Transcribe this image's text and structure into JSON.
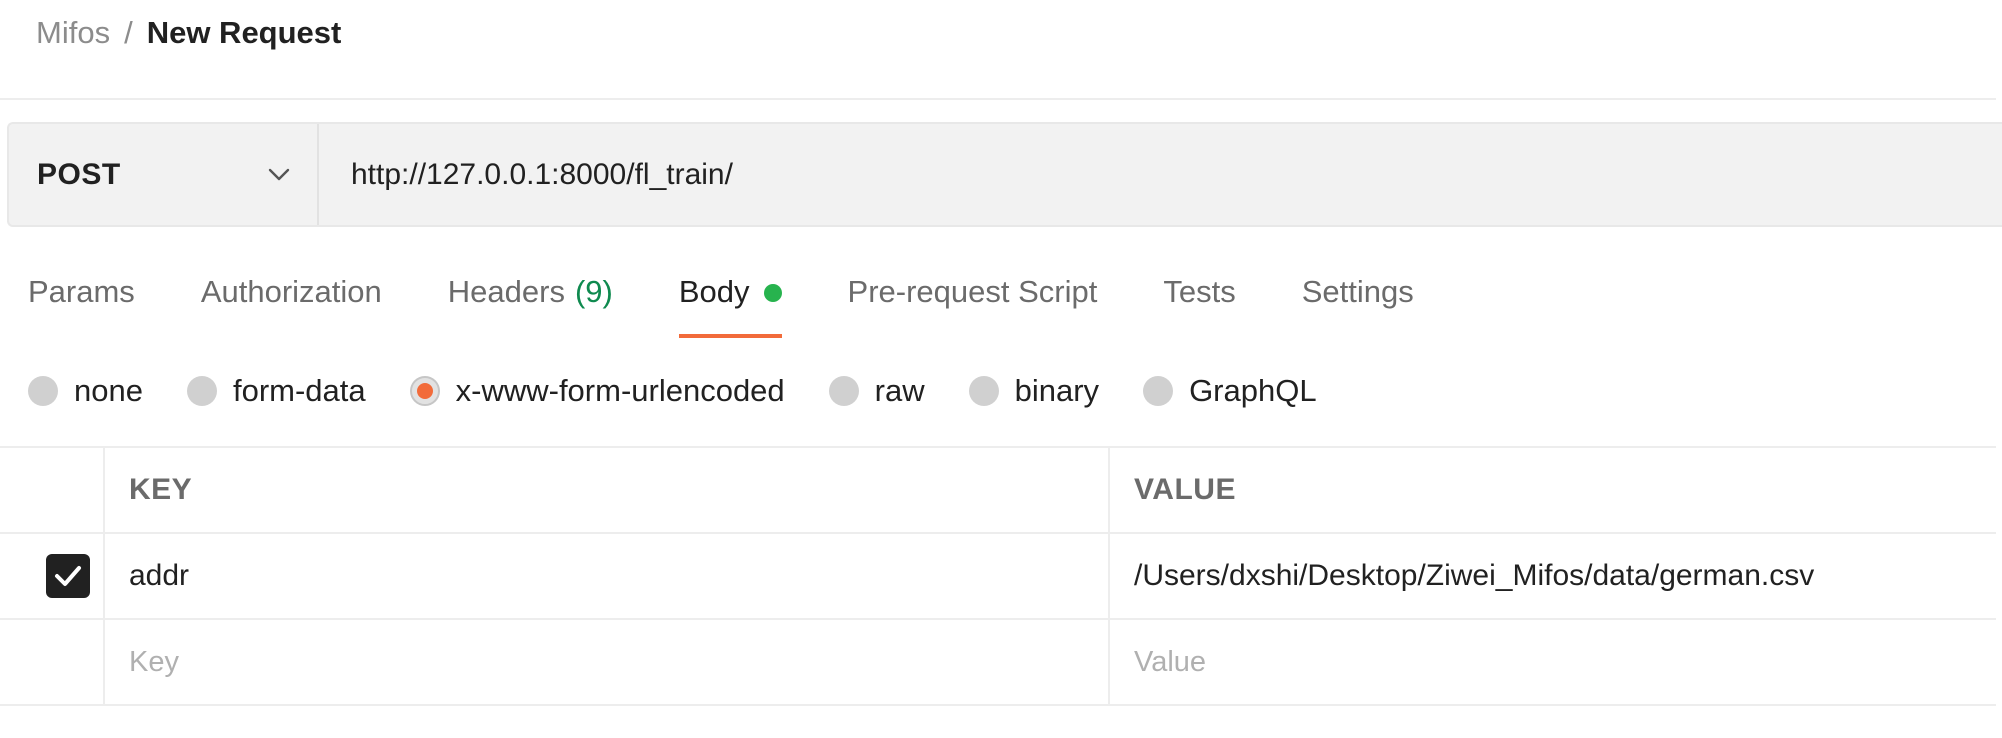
{
  "breadcrumb": {
    "parent": "Mifos",
    "separator": "/",
    "current": "New Request"
  },
  "request": {
    "method": "POST",
    "url": "http://127.0.0.1:8000/fl_train/"
  },
  "tabs": [
    {
      "label": "Params"
    },
    {
      "label": "Authorization"
    },
    {
      "label": "Headers",
      "count": "(9)"
    },
    {
      "label": "Body",
      "active": true,
      "status_color": "#27b34e"
    },
    {
      "label": "Pre-request Script"
    },
    {
      "label": "Tests"
    },
    {
      "label": "Settings"
    }
  ],
  "body_types": [
    {
      "label": "none"
    },
    {
      "label": "form-data"
    },
    {
      "label": "x-www-form-urlencoded",
      "selected": true
    },
    {
      "label": "raw"
    },
    {
      "label": "binary"
    },
    {
      "label": "GraphQL"
    }
  ],
  "table": {
    "headers": {
      "key": "KEY",
      "value": "VALUE"
    },
    "rows": [
      {
        "checked": true,
        "key": "addr",
        "value": "/Users/dxshi/Desktop/Ziwei_Mifos/data/german.csv"
      }
    ],
    "placeholder": {
      "key": "Key",
      "value": "Value"
    }
  },
  "colors": {
    "accent": "#f26b3a",
    "count_green": "#0f8a4f",
    "status_green": "#27b34e"
  },
  "icons": {
    "method_dropdown": "chevron-down-icon",
    "row_checkbox": "check-icon"
  }
}
